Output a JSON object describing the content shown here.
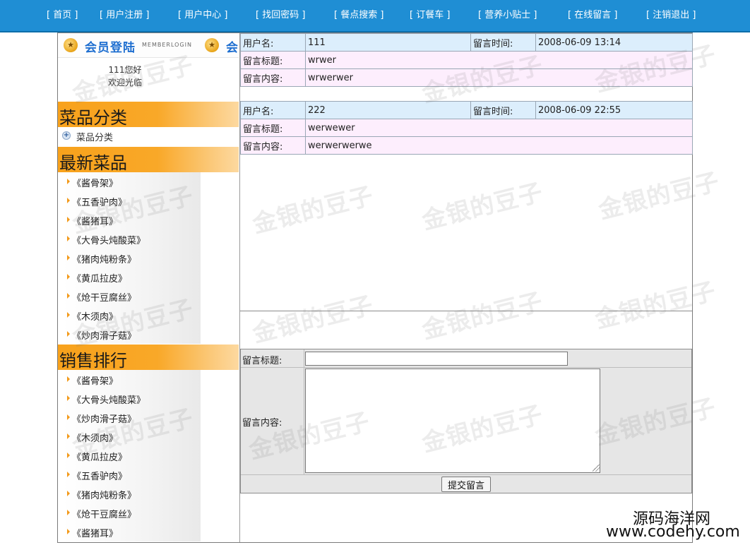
{
  "nav": {
    "items": [
      "[ 首页 ]",
      "[ 用户注册 ]",
      "[ 用户中心 ]",
      "[ 找回密码 ]",
      "[ 餐点搜索 ]",
      "[ 订餐车 ]",
      "[ 营养小贴士 ]",
      "[ 在线留言 ]",
      "[ 注销退出 ]"
    ]
  },
  "colors": {
    "nav_bg": "#1f8ed4",
    "section_head": "#f8a21c",
    "row_blue": "#dceefc",
    "row_pink": "#fdeefd"
  },
  "sidebar": {
    "login_title": "会员登陆",
    "login_title_2": "会",
    "login_subtitle": "MEMBERLOGIN",
    "welcome_line1": "111您好",
    "welcome_line2": "欢迎光临",
    "categories_heading": "菜品分类",
    "categories": [
      "菜品分类"
    ],
    "latest_heading": "最新菜品",
    "latest": [
      "《酱骨架》",
      "《五香驴肉》",
      "《酱猪耳》",
      "《大骨头炖酸菜》",
      "《猪肉炖粉条》",
      "《黄瓜拉皮》",
      "《炝干豆腐丝》",
      "《木须肉》",
      "《炒肉滑子菇》"
    ],
    "ranking_heading": "销售排行",
    "ranking": [
      "《酱骨架》",
      "《大骨头炖酸菜》",
      "《炒肉滑子菇》",
      "《木须肉》",
      "《黄瓜拉皮》",
      "《五香驴肉》",
      "《猪肉炖粉条》",
      "《炝干豆腐丝》",
      "《酱猪耳》"
    ]
  },
  "messages": {
    "labels": {
      "user": "用户名:",
      "time": "留言时间:",
      "title": "留言标题:",
      "content": "留言内容:"
    },
    "items": [
      {
        "user": "111",
        "time": "2008-06-09 13:14",
        "title": "wrwer",
        "content": "wrwerwer"
      },
      {
        "user": "222",
        "time": "2008-06-09 22:55",
        "title": "werwewer",
        "content": "werwerwerwe"
      }
    ]
  },
  "form": {
    "title_label": "留言标题:",
    "content_label": "留言内容:",
    "title_value": "",
    "content_value": "",
    "submit_label": "提交留言"
  },
  "watermark": {
    "text": "金银的豆子",
    "corner_line1": "源码海洋网",
    "corner_line2": "www.codehy.com"
  }
}
